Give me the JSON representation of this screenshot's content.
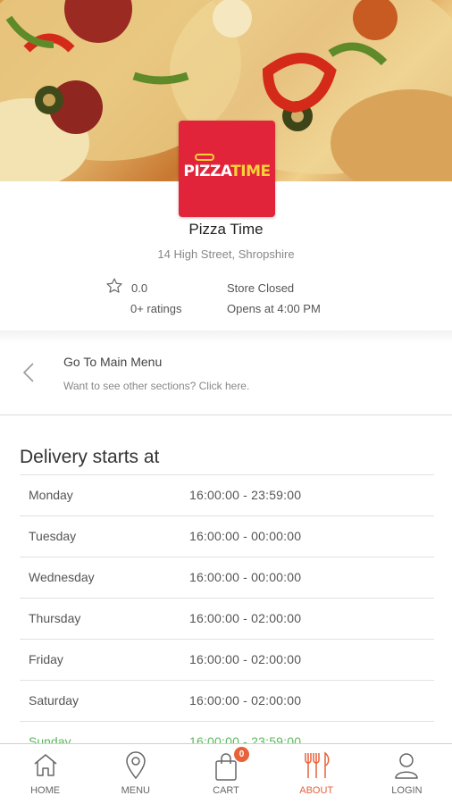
{
  "hero": {
    "image": "pizza-photo"
  },
  "logo": {
    "text_part1": "PIZZA",
    "text_part2": "TIME",
    "accent": "#e2243a"
  },
  "store": {
    "name": "Pizza Time",
    "address": "14 High Street, Shropshire",
    "rating": "0.0",
    "ratings_count": "0+ ratings",
    "status": "Store Closed",
    "opens": "Opens at 4:00 PM"
  },
  "main_menu_link": {
    "title": "Go To Main Menu",
    "subtitle": "Want to see other sections? Click here."
  },
  "delivery": {
    "title": "Delivery starts at",
    "rows": [
      {
        "day": "Monday",
        "time": "16:00:00 - 23:59:00"
      },
      {
        "day": "Tuesday",
        "time": "16:00:00 - 00:00:00"
      },
      {
        "day": "Wednesday",
        "time": "16:00:00 - 00:00:00"
      },
      {
        "day": "Thursday",
        "time": "16:00:00 - 02:00:00"
      },
      {
        "day": "Friday",
        "time": "16:00:00 - 02:00:00"
      },
      {
        "day": "Saturday",
        "time": "16:00:00 - 02:00:00"
      },
      {
        "day": "Sunday",
        "time": "16:00:00 - 23:59:00"
      }
    ],
    "today_color": "#5cb85c"
  },
  "tabbar": {
    "tabs": [
      {
        "label": "HOME",
        "icon": "home-icon"
      },
      {
        "label": "MENU",
        "icon": "location-pin-icon"
      },
      {
        "label": "CART",
        "icon": "shopping-bag-icon"
      },
      {
        "label": "ABOUT",
        "icon": "fork-knife-icon",
        "active": true
      },
      {
        "label": "LOGIN",
        "icon": "user-icon"
      }
    ],
    "cart_count": "0",
    "active_color": "#e8613a"
  }
}
